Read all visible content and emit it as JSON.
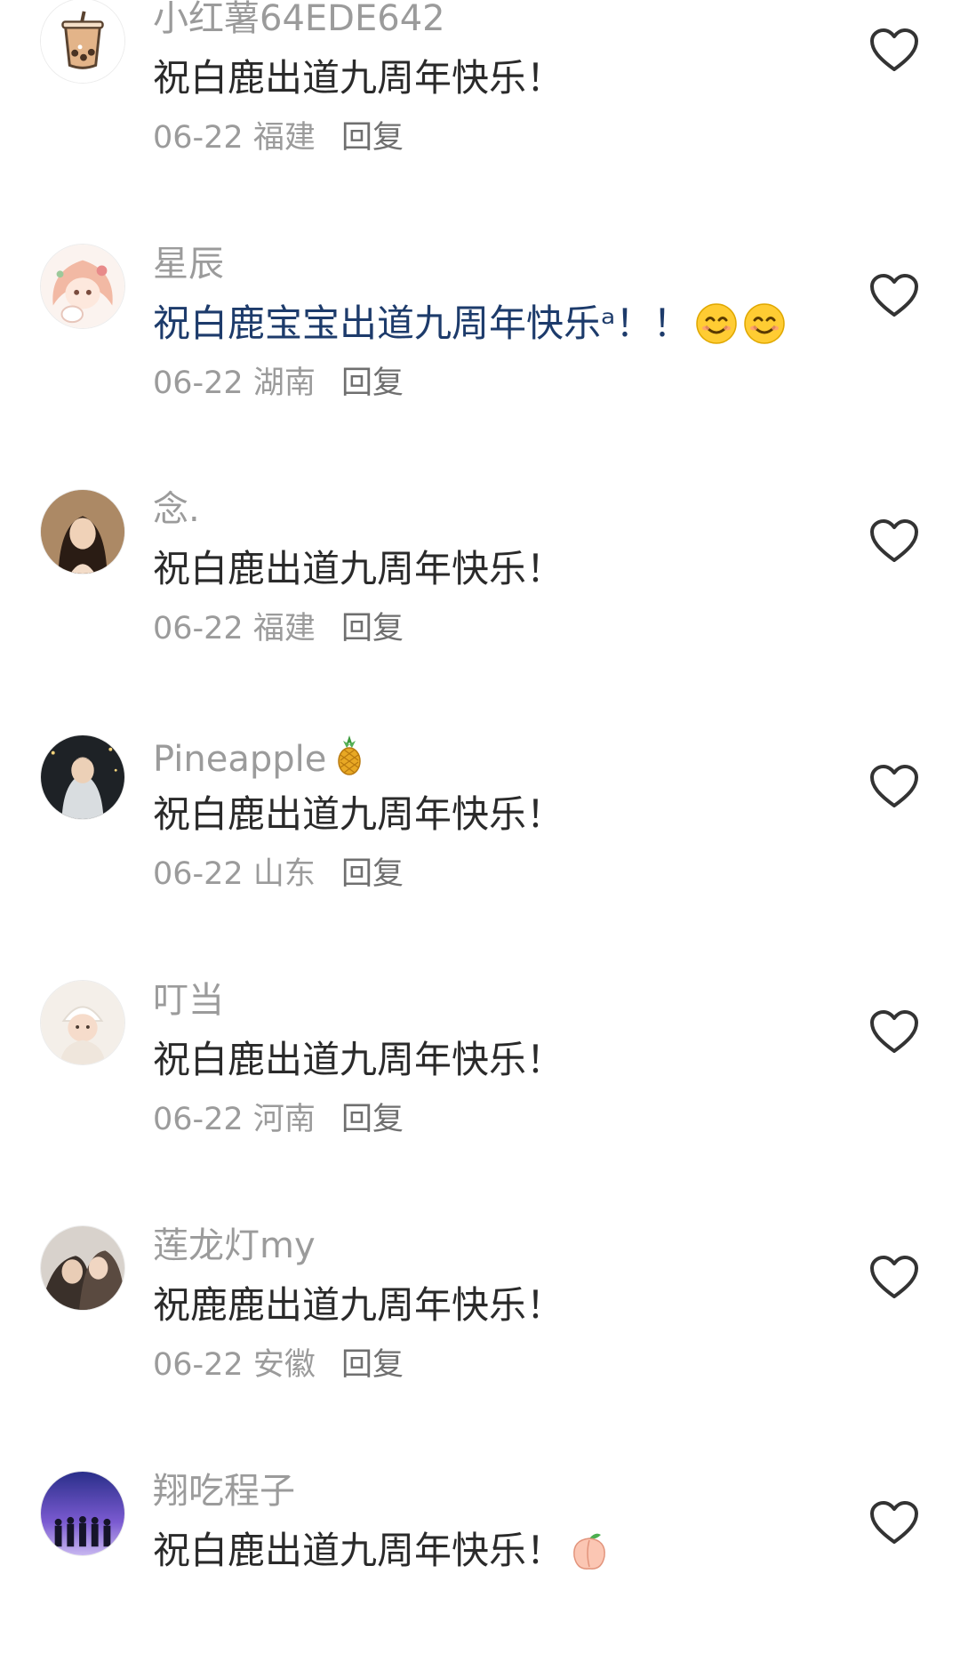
{
  "colors": {
    "background": "#ffffff",
    "username": "#9b9b9b",
    "content": "#2a2a2a",
    "topic_content": "#1d3b6b",
    "meta": "#9b9b9b",
    "heart_outline": "#333333"
  },
  "comments": [
    {
      "username": "小红薯64EDE642",
      "content": "祝白鹿出道九周年快乐！",
      "date": "06-22",
      "location": "福建",
      "reply_label": "回复",
      "avatar_icon": "bubble-tea-avatar",
      "like_icon": "heart-outline-icon"
    },
    {
      "username": "星辰",
      "content": "祝白鹿宝宝出道九周年快乐ᵃ！！",
      "content_style": "topic-link",
      "emojis": [
        "smiling-face-emoji",
        "smiling-face-emoji"
      ],
      "date": "06-22",
      "location": "湖南",
      "reply_label": "回复",
      "avatar_icon": "anime-girl-avatar",
      "like_icon": "heart-outline-icon"
    },
    {
      "username": "念.",
      "content": "祝白鹿出道九周年快乐！",
      "date": "06-22",
      "location": "福建",
      "reply_label": "回复",
      "avatar_icon": "woman-portrait-avatar",
      "like_icon": "heart-outline-icon"
    },
    {
      "username": "Pineapple",
      "username_badge": "pineapple-emoji",
      "content": "祝白鹿出道九周年快乐！",
      "date": "06-22",
      "location": "山东",
      "reply_label": "回复",
      "avatar_icon": "night-portrait-avatar",
      "like_icon": "heart-outline-icon"
    },
    {
      "username": "叮当",
      "content": "祝白鹿出道九周年快乐！",
      "date": "06-22",
      "location": "河南",
      "reply_label": "回复",
      "avatar_icon": "baby-photo-avatar",
      "like_icon": "heart-outline-icon"
    },
    {
      "username": "莲龙灯my",
      "content": "祝鹿鹿出道九周年快乐！",
      "date": "06-22",
      "location": "安徽",
      "reply_label": "回复",
      "avatar_icon": "couple-photo-avatar",
      "like_icon": "heart-outline-icon"
    },
    {
      "username": "翔吃程子",
      "content": "祝白鹿出道九周年快乐！",
      "content_emoji": "peach-emoji",
      "date": "",
      "location": "",
      "reply_label": "",
      "avatar_icon": "group-silhouette-avatar",
      "like_icon": "heart-outline-icon"
    }
  ]
}
